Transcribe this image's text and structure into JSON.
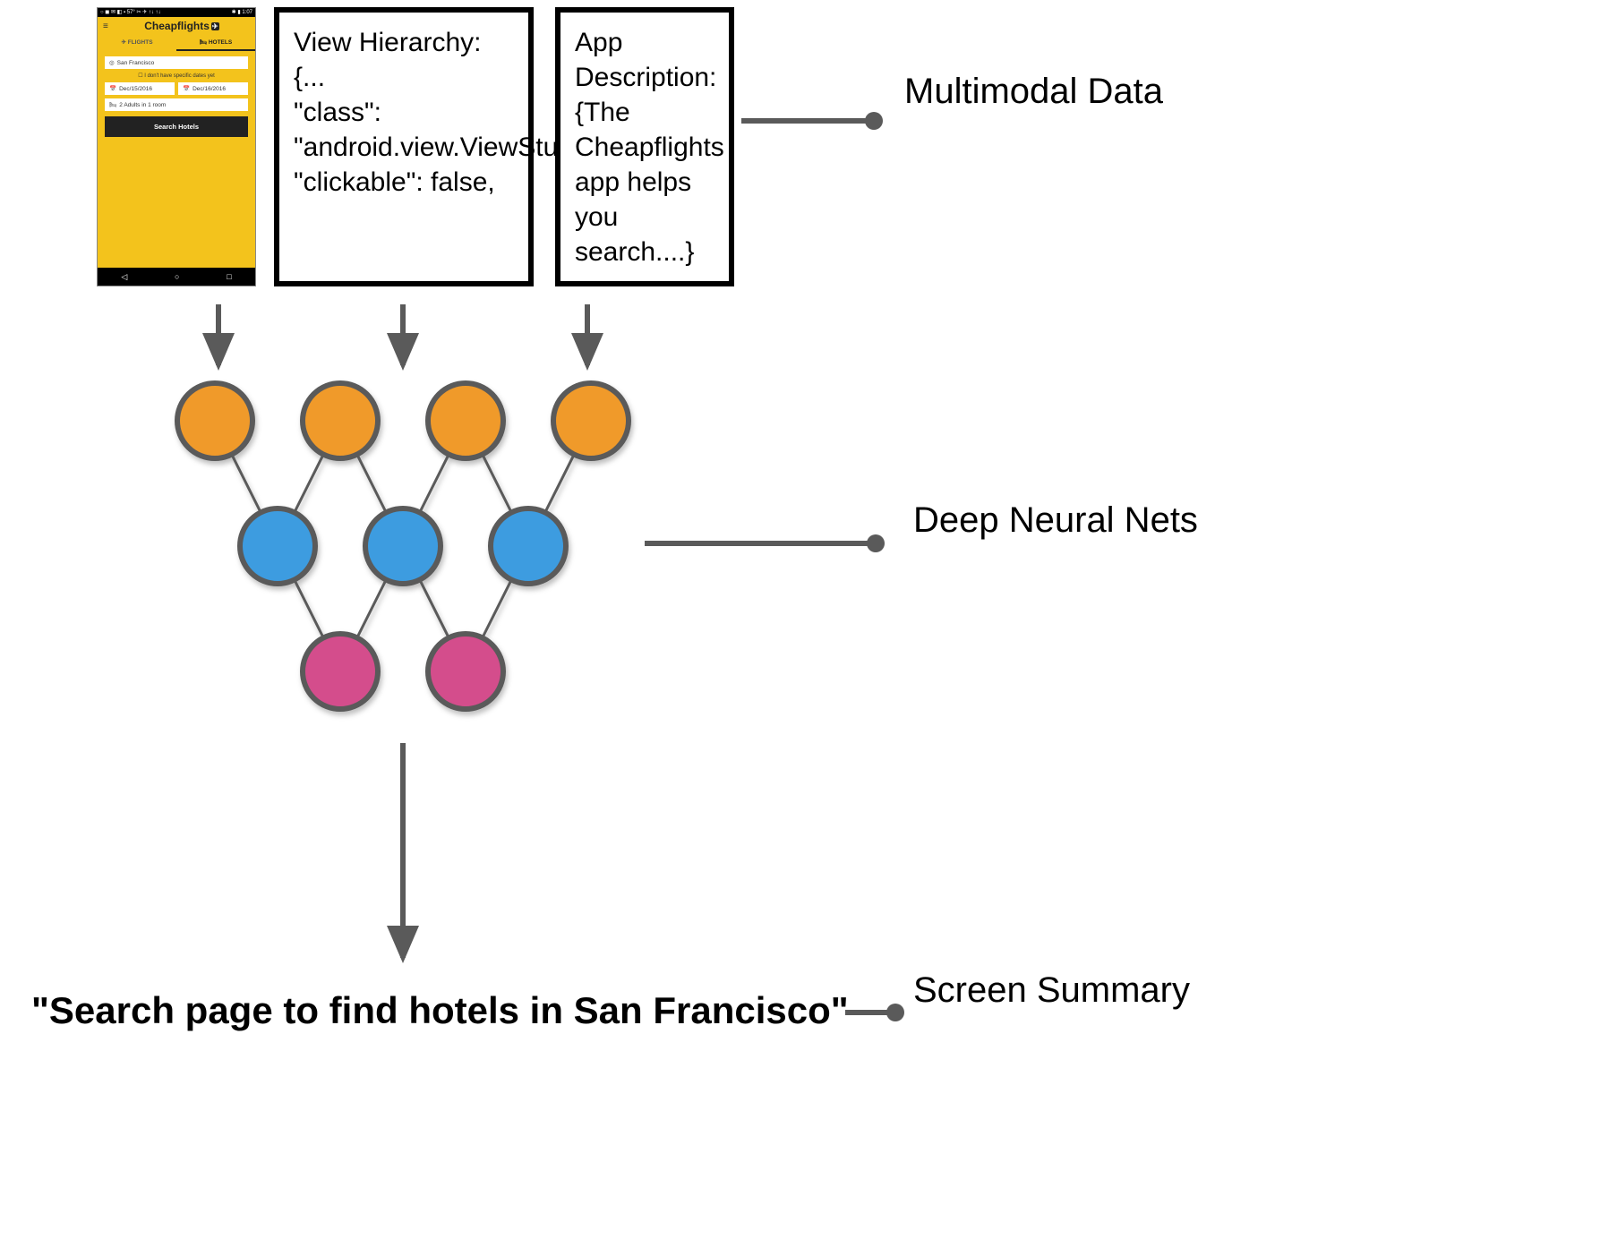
{
  "labels": {
    "multimodal_data": "Multimodal\nData",
    "deep_neural_nets": "Deep\nNeural Nets",
    "screen_summary": "Screen\nSummary"
  },
  "phone": {
    "status_left": "○ ◼ ✉ ◧ ▪ 57° ✂ ✈ ↑↓ ↑↓",
    "status_right": "✱ ▮ 1:07",
    "brand": "Cheapflights",
    "brand_icon": "✈",
    "tabs": {
      "flights": "✈ FLIGHTS",
      "hotels": "🛏 HOTELS"
    },
    "destination_icon": "◎",
    "destination": "San Francisco",
    "checkbox_label": "☐ I don't have specific dates yet",
    "date_in_icon": "📅",
    "date_in": "Dec/15/2016",
    "date_out_icon": "📅",
    "date_out": "Dec/16/2016",
    "guests_icon": "🛏",
    "guests": "2 Adults in 1 room",
    "search_button": "Search Hotels",
    "nav_back": "◁",
    "nav_home": "○",
    "nav_recent": "□"
  },
  "view_hierarchy_box": "View Hierarchy:\n{...\n\"class\":\n\"android.view.ViewStub\"\n\"clickable\": false,",
  "app_description_box": "App\nDescription:\n{The\nCheapflights\napp helps you\nsearch....}",
  "summary_output": "\"Search page to find hotels in San Francisco\"",
  "network": {
    "layers": [
      {
        "color": "#f09a2b",
        "count": 4
      },
      {
        "color": "#3c9ce0",
        "count": 3
      },
      {
        "color": "#d44e8c",
        "count": 2
      }
    ]
  }
}
